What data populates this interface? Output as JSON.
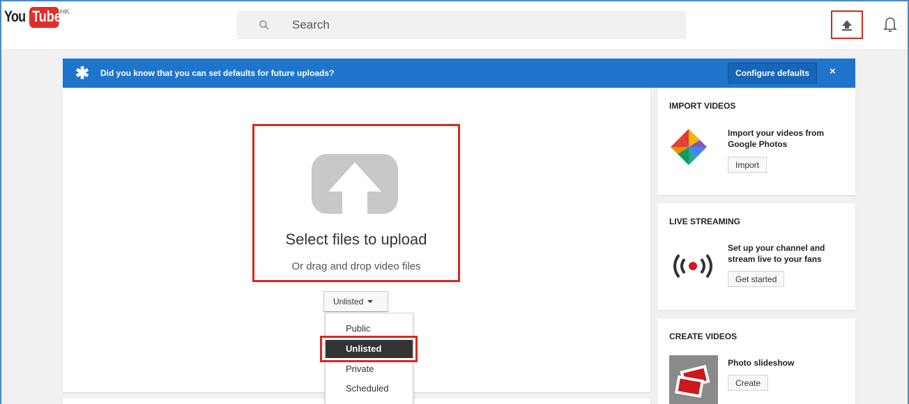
{
  "header": {
    "logo_you": "You",
    "logo_tube": "Tube",
    "logo_region": "HK",
    "search_placeholder": "Search"
  },
  "banner": {
    "text": "Did you know that you can set defaults for future uploads?",
    "configure_label": "Configure defaults",
    "close_label": "×"
  },
  "upload": {
    "title": "Select files to upload",
    "subtitle": "Or drag and drop video files",
    "privacy_selected": "Unlisted",
    "privacy_options": [
      "Public",
      "Unlisted",
      "Private",
      "Scheduled"
    ]
  },
  "side": {
    "import": {
      "title": "IMPORT VIDEOS",
      "desc": "Import your videos from Google Photos",
      "button": "Import"
    },
    "live": {
      "title": "LIVE STREAMING",
      "desc": "Set up your channel and stream live to your fans",
      "button": "Get started"
    },
    "create": {
      "title": "CREATE VIDEOS",
      "desc": "Photo slideshow",
      "button": "Create"
    }
  },
  "colors": {
    "brand_red": "#e52d27",
    "banner_blue": "#1f75cc",
    "highlight_red": "#d9281f"
  },
  "icons": [
    "search-icon",
    "upload-icon",
    "bell-icon",
    "star-icon",
    "google-photos-icon",
    "live-broadcast-icon",
    "photo-slideshow-icon"
  ]
}
